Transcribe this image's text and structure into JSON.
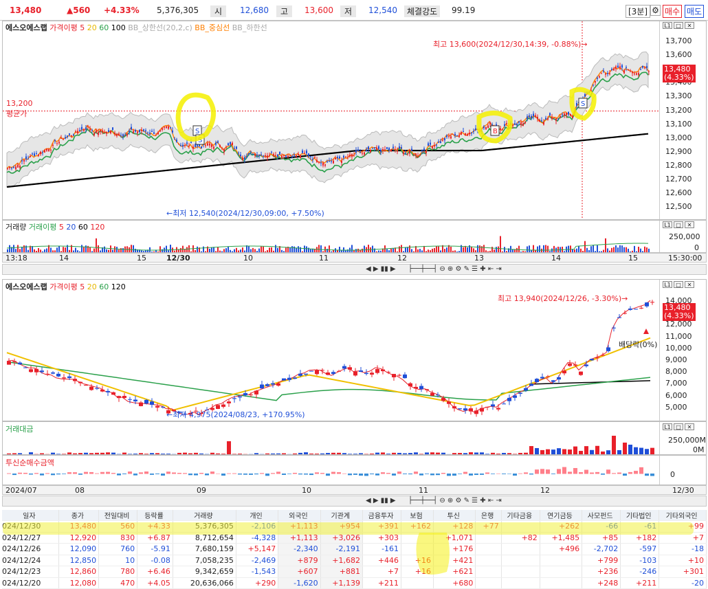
{
  "topbar": {
    "price": "13,480",
    "change": "▲560",
    "rate": "+4.33%",
    "volume": "5,376,305",
    "open_label": "시",
    "open": "12,680",
    "high_label": "고",
    "high": "13,600",
    "low_label": "저",
    "low": "12,540",
    "strength_label": "체결강도",
    "strength": "99.19",
    "interval": "[3분]",
    "buy": "매수",
    "sell": "매도"
  },
  "chart1": {
    "legend": {
      "stock": "에스오에스랩",
      "ma_label": "가격이평",
      "ma5": "5",
      "ma20": "20",
      "ma60": "60",
      "ma100": "100",
      "bb_band": "BB_상한선(20,2,c)",
      "bb_mid": "BB_중심선",
      "bb_lower": "BB_하한선"
    },
    "y_ticks": [
      "13,700",
      "13,600",
      "13,500",
      "13,400",
      "13,300",
      "13,200",
      "13,100",
      "13,000",
      "12,900",
      "12,800",
      "12,700",
      "12,600",
      "12,500"
    ],
    "last_price": "13,480",
    "last_rate": "(4.33%)",
    "avg_value": "13,200",
    "avg_label": "평균가",
    "high_note": "최고 13,600(2024/12/30,14:39, -0.88%)→",
    "low_note": "←최저 12,540(2024/12/30,09:00, +7.50%)"
  },
  "vol1": {
    "legend_vol": "거래량",
    "legend_ma": "거래이평",
    "ma5": "5",
    "ma20": "20",
    "ma60": "60",
    "ma120": "120",
    "y_top": "250,000",
    "y_zero": "0"
  },
  "axis1": {
    "labels": [
      "13:18",
      "14",
      "15",
      "12/30",
      "10",
      "11",
      "12",
      "13",
      "14",
      "15"
    ],
    "end": "15:30:00"
  },
  "chart2": {
    "legend": {
      "stock": "에스오에스랩",
      "ma_label": "가격이평",
      "ma5": "5",
      "ma20": "20",
      "ma60": "60",
      "ma120": "120"
    },
    "y_ticks": [
      "14,000",
      "13,000",
      "12,000",
      "11,000",
      "10,000",
      "9,000",
      "8,000",
      "7,000",
      "6,000",
      "5,000"
    ],
    "last_price": "13,480",
    "last_rate": "(4.33%)",
    "high_note": "최고 13,940(2024/12/26, -3.30%)→",
    "low_note": "←최저 4,975(2024/08/23, +170.95%)",
    "dividend": "배당락(0%)"
  },
  "amount": {
    "legend": "거래대금",
    "y_top": "250,000M",
    "y_zero": "0M"
  },
  "trust": {
    "legend": "투신순매수금액",
    "y_zero": "0"
  },
  "axis2": {
    "labels": [
      "2024/07",
      "08",
      "09",
      "10",
      "11",
      "12"
    ],
    "end": "12/30"
  },
  "table": {
    "headers": [
      "일자",
      "종가",
      "전일대비",
      "등락률",
      "거래량",
      "개인",
      "외국인",
      "기관계",
      "금융투자",
      "보험",
      "투신",
      "은행",
      "기타금융",
      "연기금등",
      "사모펀드",
      "기타법인",
      "기타외국인"
    ],
    "rows": [
      [
        "024/12/30",
        "13,480",
        "560",
        "+4.33",
        "5,376,305",
        "-2,106",
        "+1,113",
        "+954",
        "+391",
        "+162",
        "+128",
        "+77",
        "",
        "+262",
        "-66",
        "-61",
        "+99"
      ],
      [
        "024/12/27",
        "12,920",
        "830",
        "+6.87",
        "8,712,654",
        "-4,328",
        "+1,113",
        "+3,026",
        "+303",
        "",
        "+1,071",
        "",
        "+82",
        "+1,485",
        "+85",
        "+182",
        "+7"
      ],
      [
        "024/12/26",
        "12,090",
        "760",
        "-5.91",
        "7,680,159",
        "+5,147",
        "-2,340",
        "-2,191",
        "-161",
        "",
        "+176",
        "",
        "",
        "+496",
        "-2,702",
        "-597",
        "-18"
      ],
      [
        "024/12/24",
        "12,850",
        "10",
        "-0.08",
        "7,058,235",
        "-2,469",
        "+879",
        "+1,682",
        "+446",
        "+16",
        "+421",
        "",
        "",
        "",
        "+799",
        "-103",
        "+10"
      ],
      [
        "024/12/23",
        "12,860",
        "780",
        "+6.46",
        "9,342,659",
        "-1,543",
        "+607",
        "+881",
        "+7",
        "+16",
        "+621",
        "",
        "",
        "",
        "+236",
        "-246",
        "+301"
      ],
      [
        "024/12/20",
        "12,080",
        "470",
        "+4.05",
        "20,636,066",
        "+290",
        "-1,620",
        "+1,139",
        "+211",
        "",
        "+680",
        "",
        "",
        "",
        "+248",
        "+211",
        "-20"
      ]
    ]
  }
}
